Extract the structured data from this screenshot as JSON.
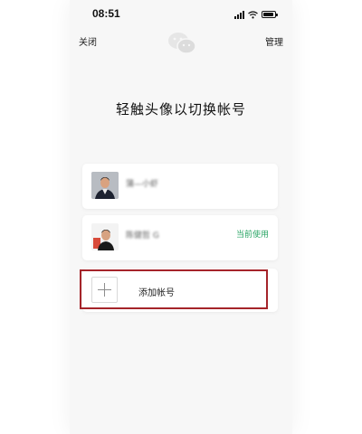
{
  "status_bar": {
    "time": "08:51"
  },
  "top_bar": {
    "close_label": "关闭",
    "manage_label": "管理"
  },
  "headline": "轻触头像以切换帐号",
  "accounts": [
    {
      "name": "蒲—小虾",
      "badge": ""
    },
    {
      "name": "陈健哲 G",
      "badge": "当前使用"
    }
  ],
  "add_account": {
    "label": "添加帐号"
  },
  "colors": {
    "accent_green": "#2aa565",
    "highlight_red": "#a5242a"
  },
  "icons": {
    "logo": "wechat-logo-icon",
    "plus": "plus-icon"
  }
}
